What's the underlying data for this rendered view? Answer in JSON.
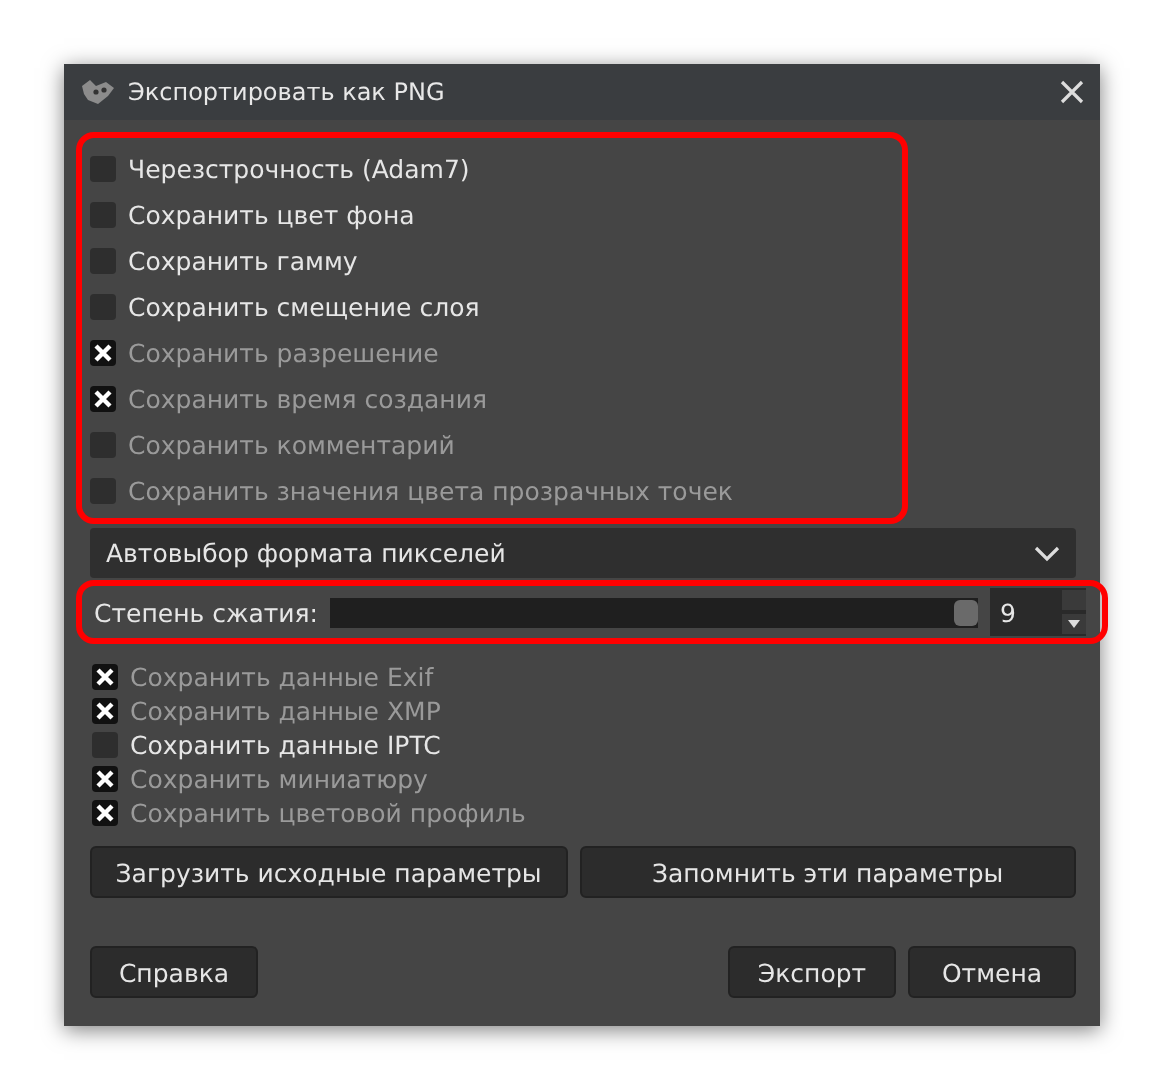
{
  "window": {
    "title": "Экспортировать как PNG"
  },
  "main_options": {
    "highlighted": true,
    "items": [
      {
        "label": "Черезстрочность (Adam7)",
        "checked": false,
        "disabled": false
      },
      {
        "label": "Сохранить цвет фона",
        "checked": false,
        "disabled": false
      },
      {
        "label": "Сохранить гамму",
        "checked": false,
        "disabled": false
      },
      {
        "label": "Сохранить смещение слоя",
        "checked": false,
        "disabled": false
      },
      {
        "label": "Сохранить разрешение",
        "checked": true,
        "disabled": true
      },
      {
        "label": "Сохранить время создания",
        "checked": true,
        "disabled": true
      },
      {
        "label": "Сохранить комментарий",
        "checked": false,
        "disabled": true
      },
      {
        "label": "Сохранить значения цвета прозрачных точек",
        "checked": false,
        "disabled": true
      }
    ]
  },
  "pixel_format": {
    "value": "Автовыбор формата пикселей"
  },
  "compression": {
    "highlighted": true,
    "label": "Степень сжатия:",
    "level": 1,
    "value": "9"
  },
  "metadata_options": [
    {
      "label": "Сохранить данные Exif",
      "checked": true,
      "disabled": true
    },
    {
      "label": "Сохранить данные XMP",
      "checked": true,
      "disabled": true
    },
    {
      "label": "Сохранить данные IPTC",
      "checked": false,
      "disabled": false
    },
    {
      "label": "Сохранить миниатюру",
      "checked": true,
      "disabled": true
    },
    {
      "label": "Сохранить цветовой профиль",
      "checked": true,
      "disabled": true
    }
  ],
  "preset_buttons": [
    "Загрузить исходные параметры",
    "Запомнить эти параметры"
  ],
  "footer": {
    "help": "Справка",
    "export": "Экспорт",
    "cancel": "Отмена"
  }
}
